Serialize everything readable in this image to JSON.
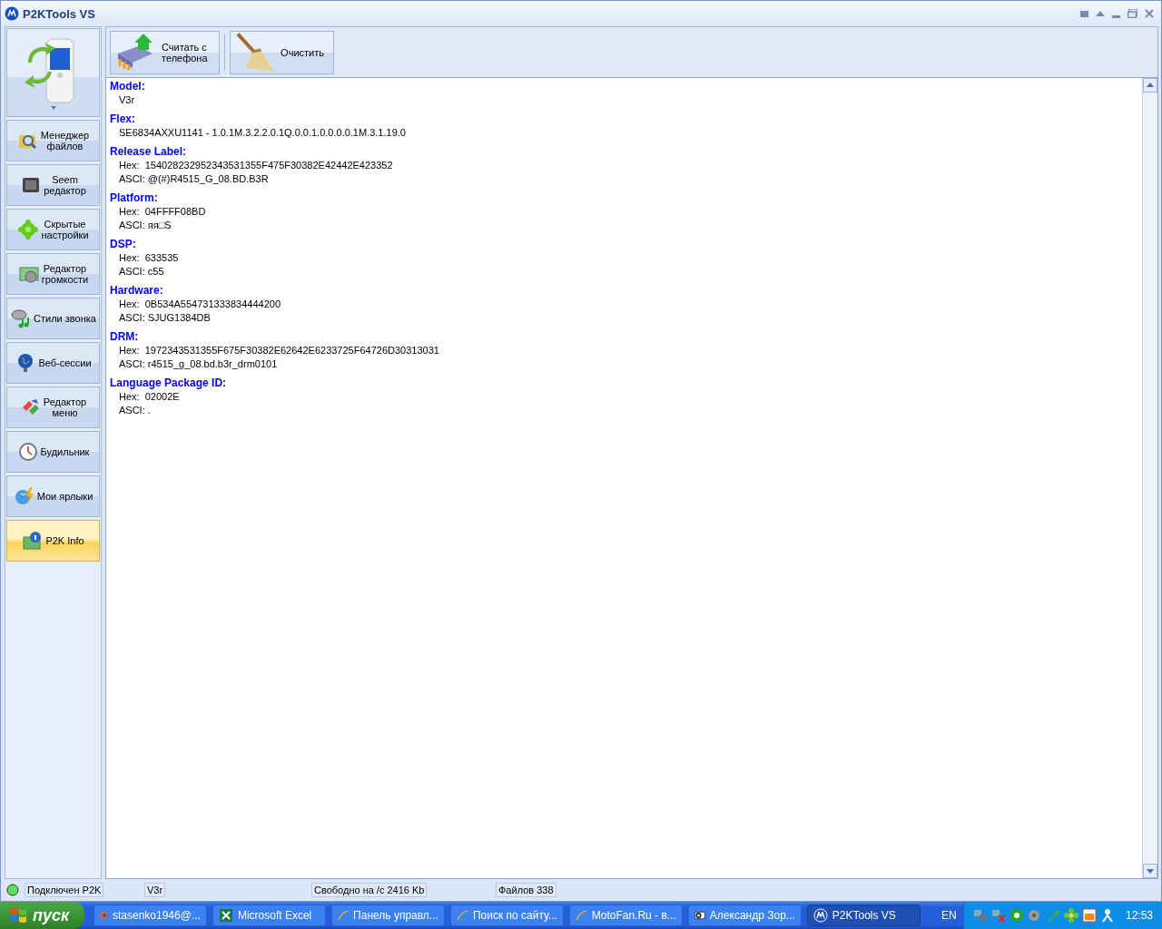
{
  "window": {
    "title": "P2KTools VS"
  },
  "toolbar": [
    {
      "label": "Считать с\nтелефона"
    },
    {
      "label": "Очистить"
    }
  ],
  "sidebar": {
    "items": [
      {
        "label": "Менеджер\nфайлов",
        "selected": false
      },
      {
        "label": "Seem\nредактор",
        "selected": false
      },
      {
        "label": "Скрытые\nнастройки",
        "selected": false
      },
      {
        "label": "Редактор\nгромкости",
        "selected": false
      },
      {
        "label": "Стили звонка",
        "selected": false
      },
      {
        "label": "Веб-сессии",
        "selected": false
      },
      {
        "label": "Редактор\nменю",
        "selected": false
      },
      {
        "label": "Будильник",
        "selected": false
      },
      {
        "label": "Мои ярлыки",
        "selected": false
      },
      {
        "label": "P2K Info",
        "selected": true
      }
    ]
  },
  "info": [
    {
      "heading": "Model:",
      "lines": [
        "V3r"
      ]
    },
    {
      "heading": "Flex:",
      "lines": [
        "SE6834AXXU1141 - 1.0.1M.3.2.2.0.1Q.0.0.1.0.0.0.0.1M.3.1.19.0"
      ]
    },
    {
      "heading": "Release Label:",
      "lines": [
        "Hex:  154028232952343531355F475F30382E42442E423352",
        "ASCI: @(#)R4515_G_08.BD.B3R"
      ]
    },
    {
      "heading": "Platform:",
      "lines": [
        "Hex:  04FFFF08BD",
        "ASCI: яя□S"
      ]
    },
    {
      "heading": "DSP:",
      "lines": [
        "Hex:  633535",
        "ASCI: c55"
      ]
    },
    {
      "heading": "Hardware:",
      "lines": [
        "Hex:  0B534A554731333834444200",
        "ASCI: SJUG1384DB"
      ]
    },
    {
      "heading": "DRM:",
      "lines": [
        "Hex:  1972343531355F675F30382E62642E6233725F64726D30313031",
        "ASCI: r4515_g_08.bd.b3r_drm0101"
      ]
    },
    {
      "heading": "Language Package ID:",
      "lines": [
        "Hex:  02002E",
        "ASCI: ."
      ]
    }
  ],
  "status_bar": [
    "Подключен P2K",
    "V3r",
    "Свободно на /c 2416 Kb",
    "Файлов 338"
  ],
  "taskbar": {
    "start": "пуск",
    "items": [
      {
        "label": "stasenko1946@...",
        "selected": false
      },
      {
        "label": "Microsoft Excel",
        "selected": false
      },
      {
        "label": "Панель управл...",
        "selected": false
      },
      {
        "label": "Поиск по сайту...",
        "selected": false
      },
      {
        "label": "MotoFan.Ru - в...",
        "selected": false
      },
      {
        "label": "Александр Зор...",
        "selected": false
      },
      {
        "label": "P2KTools VS",
        "selected": true
      }
    ],
    "language": "EN",
    "clock": "12:53"
  }
}
